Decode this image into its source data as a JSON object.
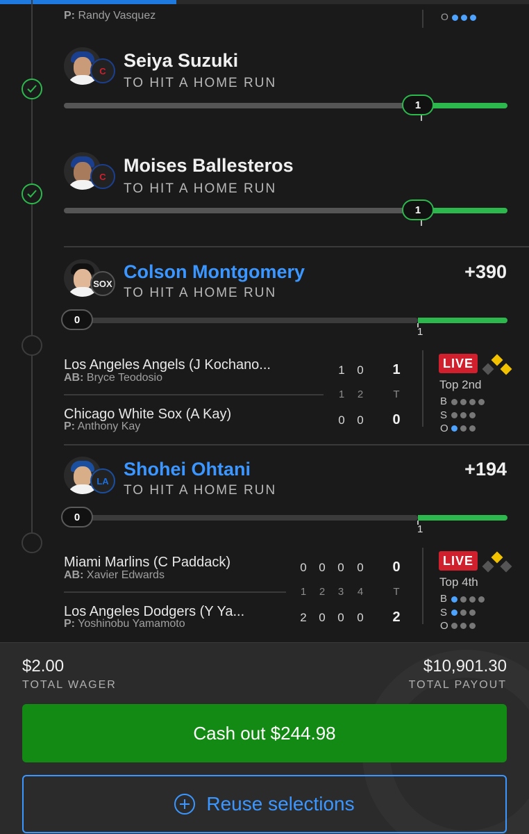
{
  "partial_row": {
    "pitcher_label": "P:",
    "pitcher_name": "Randy Vasquez",
    "outs_label": "O"
  },
  "legs": [
    {
      "player": "Seiya Suzuki",
      "market": "TO HIT A HOME RUN",
      "current": "1",
      "status": "won",
      "team_logo": "cubs-logo"
    },
    {
      "player": "Moises Ballesteros",
      "market": "TO HIT A HOME RUN",
      "current": "1",
      "status": "won",
      "team_logo": "cubs-logo"
    },
    {
      "player": "Colson Montgomery",
      "market": "TO HIT A HOME RUN",
      "odds": "+390",
      "current": "0",
      "target": "1",
      "status": "open",
      "team_logo": "white-sox-logo",
      "game": {
        "away_team": "Los Angeles Angels (J Kochano...",
        "away_sub_label": "AB:",
        "away_sub": "Bryce Teodosio",
        "home_team": "Chicago White Sox (A Kay)",
        "home_sub_label": "P:",
        "home_sub": "Anthony Kay",
        "innings": [
          "1",
          "2"
        ],
        "away_runs": [
          "1",
          "0"
        ],
        "home_runs": [
          "0",
          "0"
        ],
        "total_label": "T",
        "away_total": "1",
        "home_total": "0",
        "live": "LIVE",
        "state": "Top 2nd",
        "balls": 0,
        "strikes": 0,
        "outs": 1,
        "bso": [
          "B",
          "S",
          "O"
        ],
        "bases": {
          "first": true,
          "second": true,
          "third": false
        }
      }
    },
    {
      "player": "Shohei Ohtani",
      "market": "TO HIT A HOME RUN",
      "odds": "+194",
      "current": "0",
      "target": "1",
      "status": "open",
      "team_logo": "dodgers-logo",
      "game": {
        "away_team": "Miami Marlins (C Paddack)",
        "away_sub_label": "AB:",
        "away_sub": "Xavier Edwards",
        "home_team": "Los Angeles Dodgers (Y Ya...",
        "home_sub_label": "P:",
        "home_sub": "Yoshinobu Yamamoto",
        "innings": [
          "1",
          "2",
          "3",
          "4"
        ],
        "away_runs": [
          "0",
          "0",
          "0",
          "0"
        ],
        "home_runs": [
          "2",
          "0",
          "0",
          "0"
        ],
        "total_label": "T",
        "away_total": "0",
        "home_total": "2",
        "live": "LIVE",
        "state": "Top 4th",
        "balls": 1,
        "strikes": 1,
        "outs": 0,
        "bso": [
          "B",
          "S",
          "O"
        ],
        "bases": {
          "first": false,
          "second": true,
          "third": false
        }
      }
    }
  ],
  "footer": {
    "wager": "$2.00",
    "wager_label": "TOTAL WAGER",
    "payout": "$10,901.30",
    "payout_label": "TOTAL PAYOUT",
    "cashout": "Cash out $244.98",
    "reuse": "Reuse selections"
  },
  "colors": {
    "accent": "#3b97ff",
    "win": "#2db84d",
    "live": "#d0202e",
    "cashout": "#138a13",
    "base_on": "#f2c200"
  }
}
